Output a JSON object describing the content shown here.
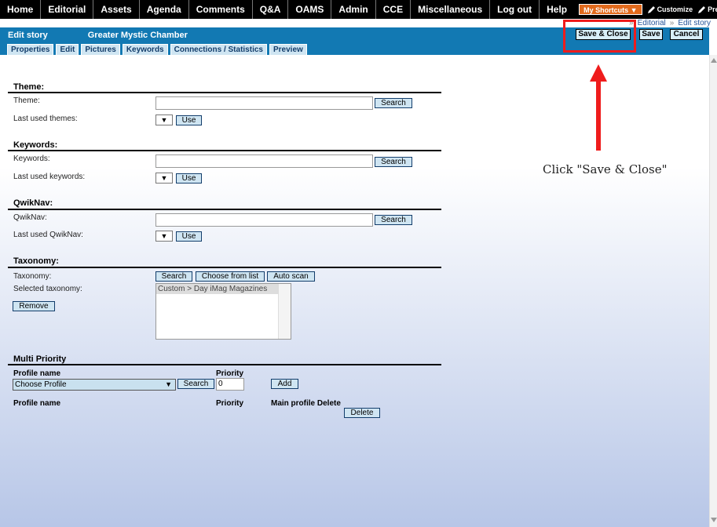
{
  "topnav": {
    "items": [
      "Home",
      "Editorial",
      "Assets",
      "Agenda",
      "Comments",
      "Q&A",
      "OAMS",
      "Admin",
      "CCE",
      "Miscellaneous",
      "Log out",
      "Help"
    ],
    "shortcuts": "My Shortcuts ▼",
    "customize": "Customize",
    "preferences": "Preferences"
  },
  "breadcrumb": {
    "separator": "»",
    "items": [
      "Editorial",
      "Edit story"
    ]
  },
  "titlebar": {
    "title": "Edit story",
    "story_name": "Greater Mystic Chamber",
    "save_close": "Save & Close",
    "save": "Save",
    "cancel": "Cancel"
  },
  "tabs": [
    "Properties",
    "Edit",
    "Pictures",
    "Keywords",
    "Connections / Statistics",
    "Preview"
  ],
  "theme": {
    "heading": "Theme:",
    "label": "Theme:",
    "last_label": "Last used themes:",
    "search": "Search",
    "use": "Use"
  },
  "keywords": {
    "heading": "Keywords:",
    "label": "Keywords:",
    "last_label": "Last used keywords:",
    "search": "Search",
    "use": "Use"
  },
  "qwiknav": {
    "heading": "QwikNav:",
    "label": "QwikNav:",
    "last_label": "Last used QwikNav:",
    "search": "Search",
    "use": "Use"
  },
  "taxonomy": {
    "heading": "Taxonomy:",
    "label": "Taxonomy:",
    "selected_label": "Selected taxonomy:",
    "search": "Search",
    "choose": "Choose from list",
    "auto": "Auto scan",
    "remove": "Remove",
    "selected_items": [
      "Custom > Day iMag Magazines"
    ]
  },
  "priority": {
    "heading": "Multi Priority",
    "profile_col": "Profile name",
    "priority_col": "Priority",
    "profile_select": "Choose Profile",
    "priority_value": "0",
    "search": "Search",
    "add": "Add",
    "table_headers": [
      "Profile name",
      "Priority",
      "Main profile Delete"
    ],
    "delete": "Delete"
  },
  "mini_select": "▼",
  "annotation": {
    "text": "Click \"Save & Close\"",
    "color": "#ef1c1c"
  },
  "colors": {
    "nav_bg": "#000000",
    "titlebar": "#1279b3",
    "shortcuts": "#e26a1c",
    "tab_bg": "#cfe5f2"
  }
}
